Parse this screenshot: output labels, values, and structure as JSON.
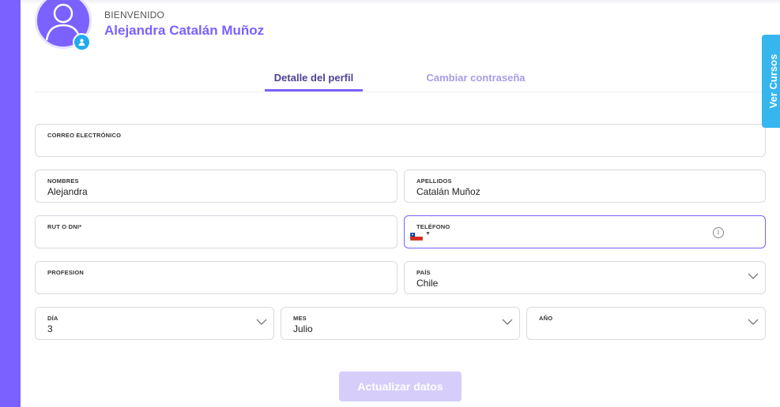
{
  "header": {
    "welcome": "BIENVENIDO",
    "user_name": "Alejandra Catalán Muñoz"
  },
  "tabs": [
    {
      "label": "Detalle del perfil",
      "active": true
    },
    {
      "label": "Cambiar contraseña",
      "active": false
    }
  ],
  "form": {
    "email": {
      "label": "CORREO ELECTRÓNICO",
      "value": ""
    },
    "first_name": {
      "label": "NOMBRES",
      "value": "Alejandra"
    },
    "last_name": {
      "label": "APELLIDOS",
      "value": "Catalán Muñoz"
    },
    "rut": {
      "label": "RUT O DNI*",
      "value": ""
    },
    "phone": {
      "label": "TELÉFONO",
      "value": "",
      "flag": "chile-flag-icon"
    },
    "profession": {
      "label": "PROFESION",
      "value": ""
    },
    "country": {
      "label": "PAÍS",
      "value": "Chile"
    },
    "day": {
      "label": "DÍA",
      "value": "3"
    },
    "month": {
      "label": "MES",
      "value": "Julio"
    },
    "year": {
      "label": "AÑO",
      "value": ""
    }
  },
  "submit_label": "Actualizar datos",
  "side_tab_label": "Ver Cursos",
  "colors": {
    "accent": "#7b61ff",
    "side_tab": "#35b6ef",
    "submit_disabled": "#d6cdfb"
  }
}
